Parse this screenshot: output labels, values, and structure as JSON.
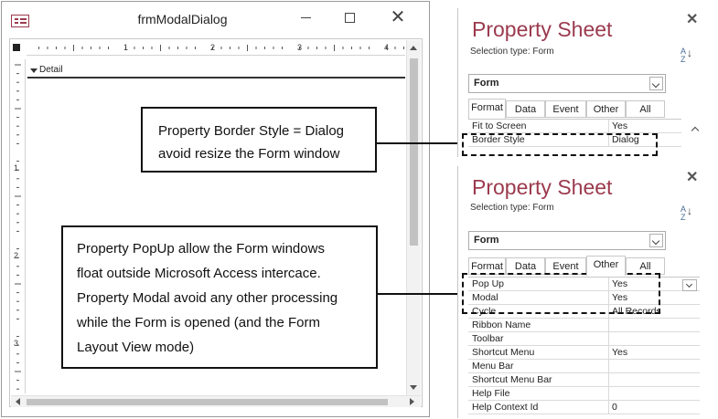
{
  "form_window": {
    "title": "frmModalDialog",
    "ruler_numbers": [
      "1",
      "2",
      "3",
      "4"
    ],
    "vruler_numbers": [
      "1",
      "2",
      "3"
    ],
    "section_label": "Detail"
  },
  "callouts": {
    "border_style": [
      "Property Border Style = Dialog",
      "avoid resize the Form window"
    ],
    "popup_modal": [
      "Property PopUp allow the Form windows",
      "float outside Microsoft Access intercace.",
      "Property Modal avoid any other processing",
      "while the Form is opened (and the Form",
      "Layout View mode)"
    ]
  },
  "property_sheet_1": {
    "title": "Property Sheet",
    "selection_type_label": "Selection type:",
    "selection_type_value": "Form",
    "object_selector": "Form",
    "tabs": [
      "Format",
      "Data",
      "Event",
      "Other",
      "All"
    ],
    "active_tab": "Format",
    "rows": [
      {
        "name": "Fit to Screen",
        "value": "Yes"
      },
      {
        "name": "Border Style",
        "value": "Dialog"
      }
    ]
  },
  "property_sheet_2": {
    "title": "Property Sheet",
    "selection_type_label": "Selection type:",
    "selection_type_value": "Form",
    "object_selector": "Form",
    "tabs": [
      "Format",
      "Data",
      "Event",
      "Other",
      "All"
    ],
    "active_tab": "Other",
    "rows": [
      {
        "name": "Pop Up",
        "value": "Yes"
      },
      {
        "name": "Modal",
        "value": "Yes"
      },
      {
        "name": "Cycle",
        "value": "All Records"
      },
      {
        "name": "Ribbon Name",
        "value": ""
      },
      {
        "name": "Toolbar",
        "value": ""
      },
      {
        "name": "Shortcut Menu",
        "value": "Yes"
      },
      {
        "name": "Menu Bar",
        "value": ""
      },
      {
        "name": "Shortcut Menu Bar",
        "value": ""
      },
      {
        "name": "Help File",
        "value": ""
      },
      {
        "name": "Help Context Id",
        "value": "0"
      }
    ]
  },
  "colors": {
    "sheet_title": "#9b3a4e",
    "app_icon": "#9b3a4e"
  },
  "icons": {
    "sort": "sort-az-icon",
    "close": "close-icon",
    "dropdown": "chevron-down-icon"
  }
}
